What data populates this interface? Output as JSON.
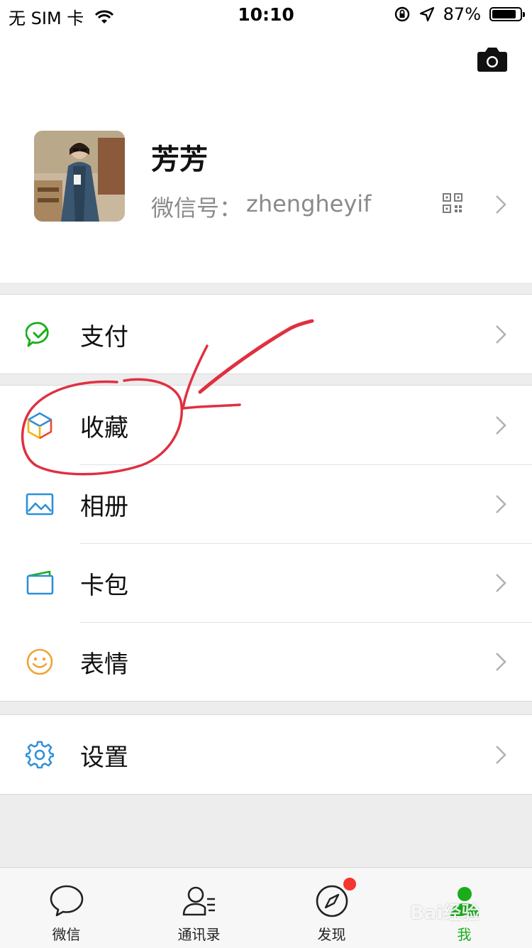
{
  "status_bar": {
    "carrier": "无 SIM 卡",
    "time": "10:10",
    "battery_percent": "87%",
    "battery_level": 0.87
  },
  "profile": {
    "name": "芳芳",
    "wechat_id_label": "微信号：",
    "wechat_id": "zhengheyif"
  },
  "menu": {
    "pay": "支付",
    "favorites": "收藏",
    "album": "相册",
    "cards": "卡包",
    "stickers": "表情",
    "settings": "设置"
  },
  "tabbar": {
    "chats": "微信",
    "contacts": "通讯录",
    "discover": "发现",
    "me": "我"
  },
  "watermark": "Bai经验",
  "colors": {
    "accent_green": "#1aad19",
    "annotation_red": "#e03040",
    "badge_red": "#f43530"
  }
}
